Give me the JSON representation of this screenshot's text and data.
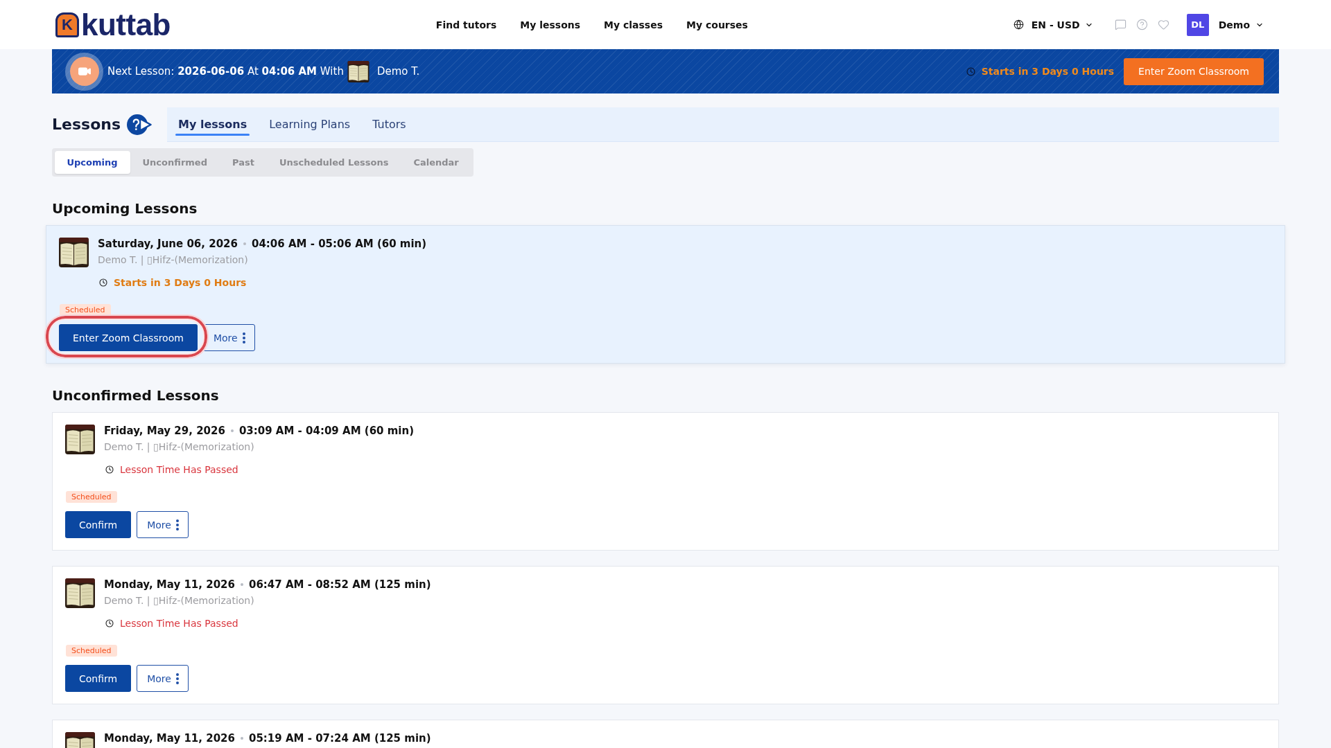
{
  "header": {
    "logo": {
      "mark": "K",
      "name": "kuttab"
    },
    "nav": [
      {
        "label": "Find tutors"
      },
      {
        "label": "My lessons"
      },
      {
        "label": "My classes"
      },
      {
        "label": "My courses"
      }
    ],
    "locale": "EN - USD",
    "user": {
      "initials": "DL",
      "name": "Demo"
    }
  },
  "next_lesson": {
    "text": "Next Lesson: **2026-06-06** At **04:06 AM** With",
    "tutor": "Demo T.",
    "countdown": "Starts in 3 Days 0 Hours",
    "button": "Enter Zoom Classroom"
  },
  "lessons": {
    "title": "Lessons",
    "tabs": [
      {
        "label": "My lessons",
        "selected": true
      },
      {
        "label": "Learning Plans",
        "selected": false
      },
      {
        "label": "Tutors",
        "selected": false
      }
    ],
    "filters": [
      {
        "label": "Upcoming",
        "selected": true
      },
      {
        "label": "Unconfirmed",
        "selected": false
      },
      {
        "label": "Past",
        "selected": false
      },
      {
        "label": "Unscheduled Lessons",
        "selected": false
      },
      {
        "label": "Calendar",
        "selected": false
      }
    ]
  },
  "sections": [
    {
      "kind": "upcoming",
      "heading": "Upcoming Lessons",
      "cards": [
        {
          "date": "Saturday, June 06, 2026",
          "time": "04:06 AM - 05:06 AM (60 min)",
          "subtitle": "Demo T. | ▯Hifz-(Memorization)",
          "status": {
            "kind": "countdown",
            "text": "Starts in 3 Days 0 Hours"
          },
          "badge": "Scheduled",
          "primary_action": {
            "label": "Enter Zoom Classroom",
            "highlighted": true
          },
          "more": "More"
        }
      ]
    },
    {
      "kind": "unconfirmed",
      "heading": "Unconfirmed Lessons",
      "cards": [
        {
          "date": "Friday, May 29, 2026",
          "time": "03:09 AM - 04:09 AM (60 min)",
          "subtitle": "Demo T. | ▯Hifz-(Memorization)",
          "status": {
            "kind": "passed",
            "text": "Lesson Time Has Passed"
          },
          "badge": "Scheduled",
          "primary_action": {
            "label": "Confirm",
            "highlighted": false
          },
          "more": "More"
        },
        {
          "date": "Monday, May 11, 2026",
          "time": "06:47 AM - 08:52 AM (125 min)",
          "subtitle": "Demo T. | ▯Hifz-(Memorization)",
          "status": {
            "kind": "passed",
            "text": "Lesson Time Has Passed"
          },
          "badge": "Scheduled",
          "primary_action": {
            "label": "Confirm",
            "highlighted": false
          },
          "more": "More"
        },
        {
          "date": "Monday, May 11, 2026",
          "time": "05:19 AM - 07:24 AM (125 min)"
        }
      ]
    }
  ]
}
